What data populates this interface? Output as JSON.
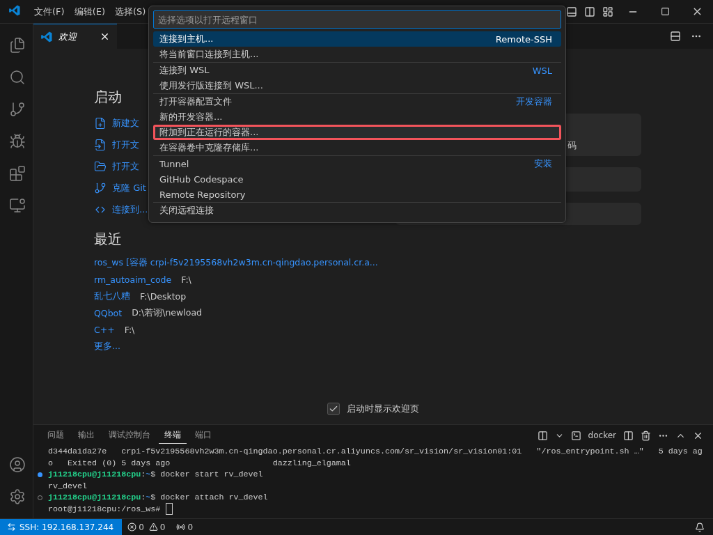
{
  "title_bar": {
    "menus": [
      {
        "label": "文件(F)"
      },
      {
        "label": "编辑(E)"
      },
      {
        "label": "选择(S)"
      }
    ]
  },
  "activity_bar": {
    "top": [
      {
        "kind": "explorer",
        "selected": false
      },
      {
        "kind": "search",
        "selected": false
      },
      {
        "kind": "scm",
        "selected": false
      },
      {
        "kind": "debug",
        "selected": false
      },
      {
        "kind": "extensions",
        "selected": false
      },
      {
        "kind": "remote",
        "selected": false
      }
    ],
    "bottom": [
      {
        "kind": "account"
      },
      {
        "kind": "settings"
      }
    ]
  },
  "editor_tabs": [
    {
      "label": "欢迎",
      "selected": true
    }
  ],
  "welcome": {
    "start_heading": "启动",
    "start_items": [
      {
        "kind": "new-file",
        "label": "新建文"
      },
      {
        "kind": "open-file",
        "label": "打开文"
      },
      {
        "kind": "open-folder",
        "label": "打开文"
      },
      {
        "kind": "clone",
        "label": "克隆 Git"
      },
      {
        "kind": "connect",
        "label": "连接到..."
      }
    ],
    "recent_heading": "最近",
    "recent": [
      {
        "name": "ros_ws [容器 crpi-f5v2195568vh2w3m.cn-qingdao.personal.cr.a..."
      },
      {
        "name": "rm_autoaim_code",
        "path": "F:\\"
      },
      {
        "name": "乱七八糟",
        "path": "F:\\Desktop"
      },
      {
        "name": "QQbot",
        "path": "D:\\若诩\\newload"
      },
      {
        "name": "C++",
        "path": "F:\\"
      }
    ],
    "more": "更多...",
    "cards": [
      {
        "text": "码"
      }
    ],
    "show_on_startup": {
      "label": "启动时显示欢迎页",
      "checked": true
    }
  },
  "quick_pick": {
    "placeholder": "选择选项以打开远程窗口",
    "groups": [
      {
        "items": [
          {
            "label": "连接到主机...",
            "detail": "Remote-SSH",
            "selected": true,
            "outlined": false
          },
          {
            "label": "将当前窗口连接到主机...",
            "selected": false,
            "outlined": false
          }
        ]
      },
      {
        "items": [
          {
            "label": "连接到 WSL",
            "detail": "WSL",
            "selected": false,
            "outlined": false
          },
          {
            "label": "使用发行版连接到 WSL...",
            "selected": false,
            "outlined": false
          }
        ]
      },
      {
        "items": [
          {
            "label": "打开容器配置文件",
            "detail": "开发容器",
            "selected": false,
            "outlined": false
          },
          {
            "label": "新的开发容器...",
            "selected": false,
            "outlined": false
          },
          {
            "label": "附加到正在运行的容器...",
            "selected": false,
            "outlined": true
          },
          {
            "label": "在容器卷中克隆存储库...",
            "selected": false,
            "outlined": false
          }
        ]
      },
      {
        "items": [
          {
            "label": "Tunnel",
            "detail": "安装",
            "selected": false,
            "outlined": false
          },
          {
            "label": "GitHub Codespace",
            "selected": false,
            "outlined": false
          },
          {
            "label": "Remote Repository",
            "selected": false,
            "outlined": false
          }
        ]
      },
      {
        "items": [
          {
            "label": "关闭远程连接",
            "selected": false,
            "outlined": false
          }
        ]
      }
    ]
  },
  "panel": {
    "tabs": [
      {
        "label": "问题",
        "selected": false
      },
      {
        "label": "输出",
        "selected": false
      },
      {
        "label": "调试控制台",
        "selected": false
      },
      {
        "label": "终端",
        "selected": true
      },
      {
        "label": "端口",
        "selected": false
      }
    ],
    "terminal_name": "docker",
    "terminal": [
      {
        "kind": "output",
        "text": "d344da1da27e   crpi-f5v2195568vh2w3m.cn-qingdao.personal.cr.aliyuncs.com/sr_vision/sr_vision01:01   \"/ros_entrypoint.sh …\"   5 days ag"
      },
      {
        "kind": "output",
        "text": "o   Exited (0) 5 days ago                     dazzling_elgamal"
      },
      {
        "kind": "prompt",
        "succeeded": true,
        "user": "j11218cpu@j11218cpu",
        "sep": ":",
        "path": "~",
        "sign": "$",
        "command": "docker start rv_devel"
      },
      {
        "kind": "output",
        "text": "rv_devel"
      },
      {
        "kind": "prompt",
        "succeeded": false,
        "user": "j11218cpu@j11218cpu",
        "sep": ":",
        "path": "~",
        "sign": "$",
        "command": "docker attach rv_devel"
      },
      {
        "kind": "input",
        "text": "root@j11218cpu:/ros_ws#"
      }
    ]
  },
  "status_bar": {
    "remote": "SSH: 192.168.137.244",
    "errors": "0",
    "warnings": "0",
    "ports": "0"
  }
}
